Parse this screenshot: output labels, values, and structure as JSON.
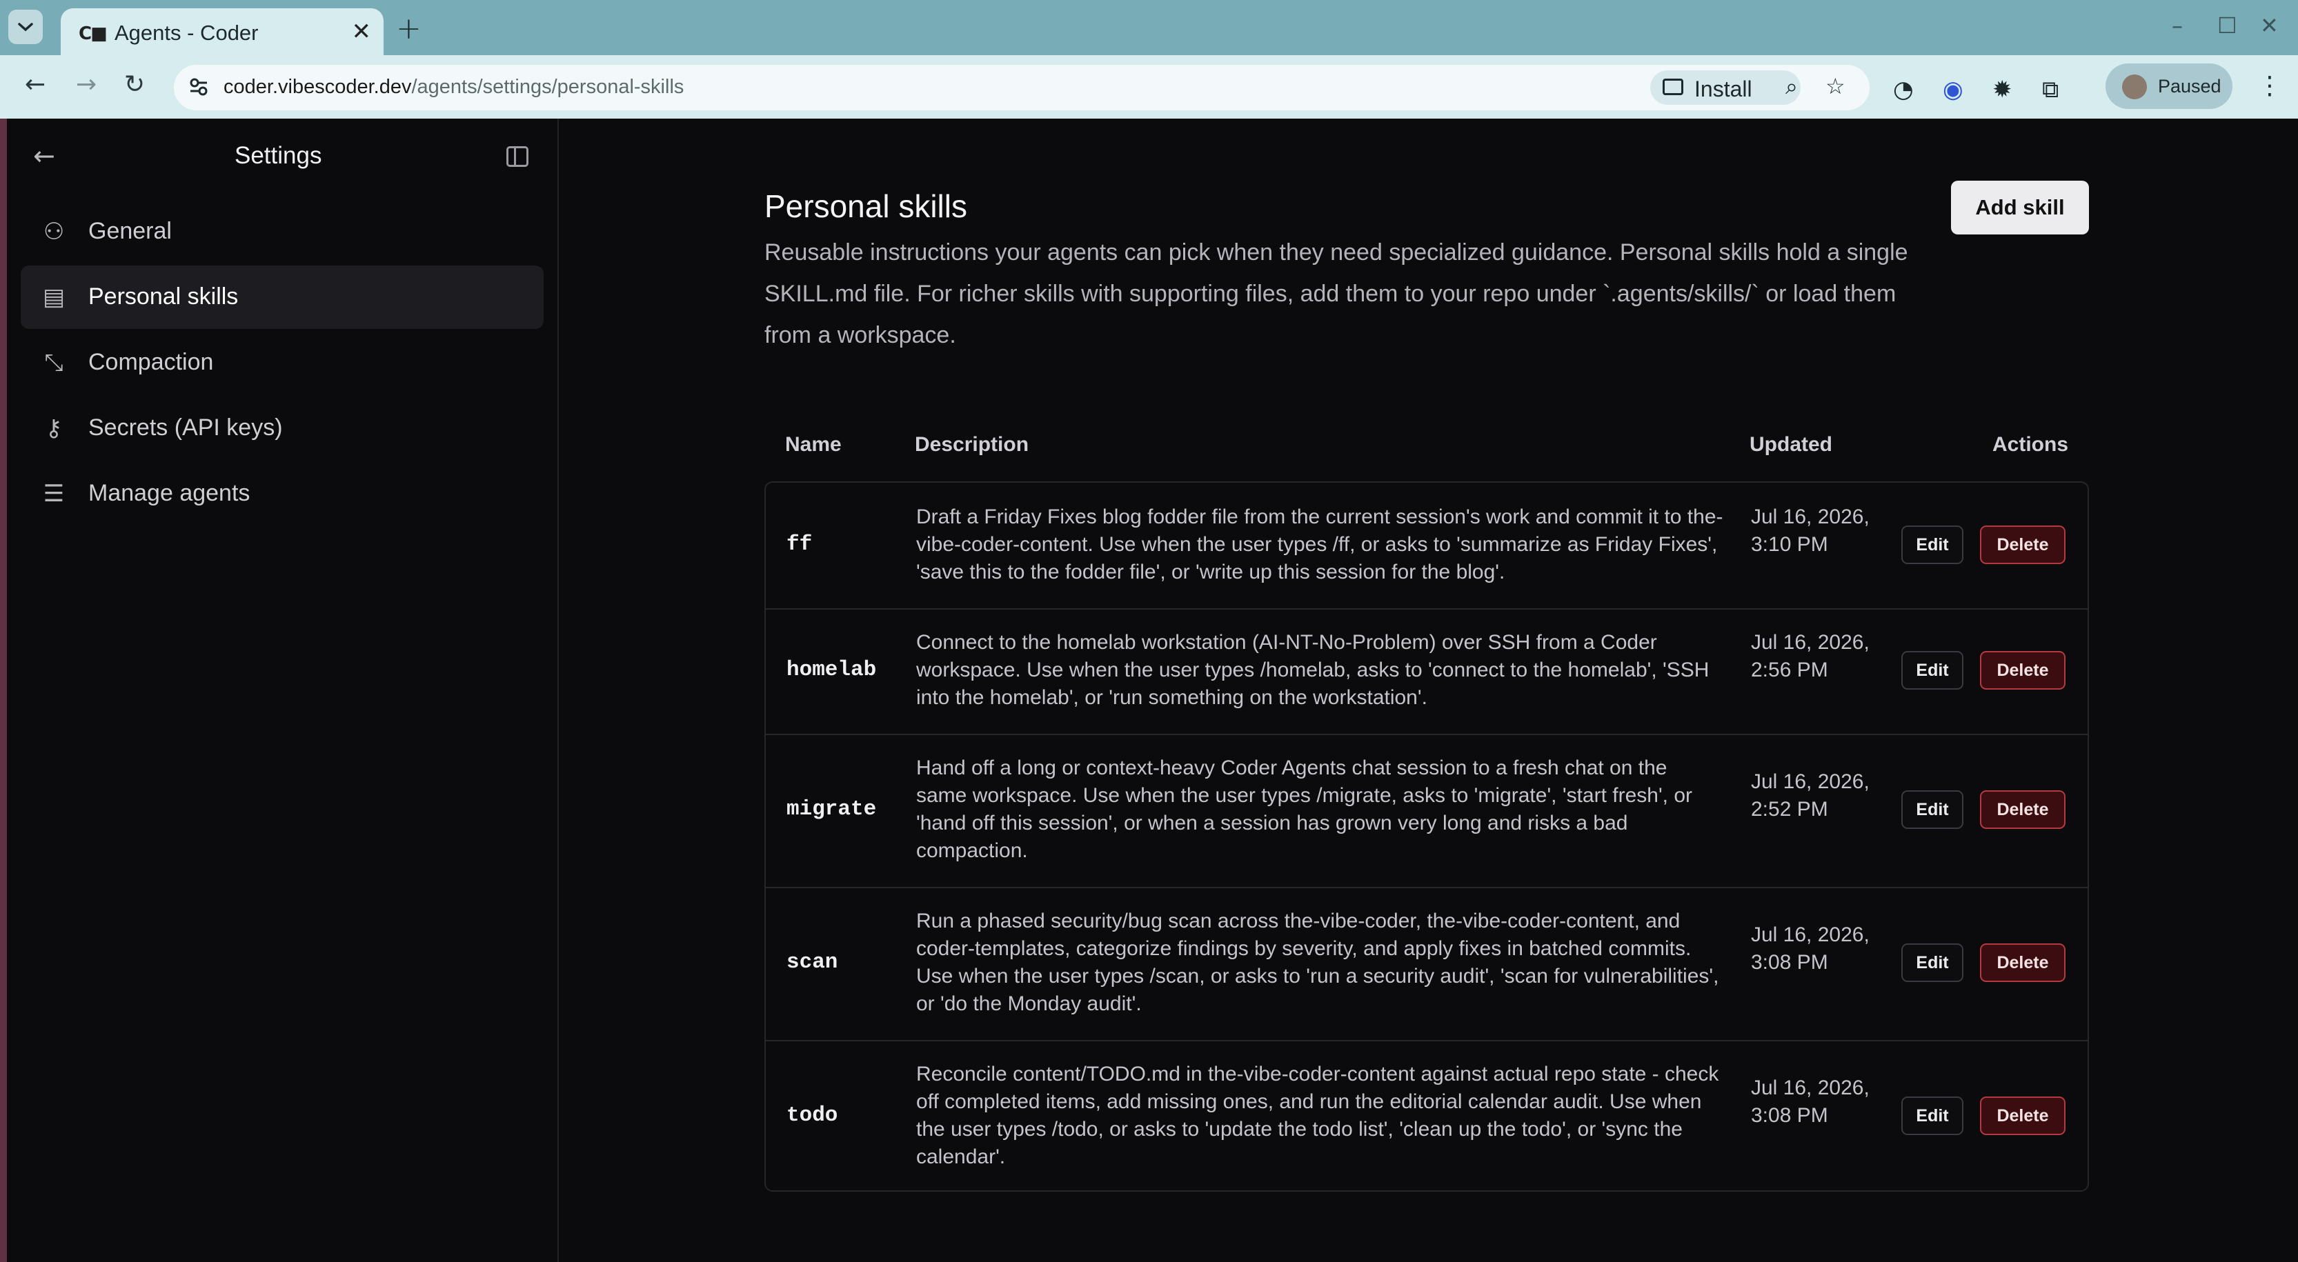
{
  "browser": {
    "tab_title": "Agents - Coder",
    "tab_favicon": "C■",
    "url_host": "coder.vibescoder.dev",
    "url_path": "/agents/settings/personal-skills",
    "install_label": "Install",
    "profile_label": "Paused"
  },
  "sidebar": {
    "title": "Settings",
    "items": [
      {
        "label": "General",
        "icon": "user-icon",
        "glyph": "⚇",
        "active": false
      },
      {
        "label": "Personal skills",
        "icon": "document-icon",
        "glyph": "▤",
        "active": true
      },
      {
        "label": "Compaction",
        "icon": "compress-icon",
        "glyph": "⤡",
        "active": false
      },
      {
        "label": "Secrets (API keys)",
        "icon": "key-icon",
        "glyph": "⚷",
        "active": false
      },
      {
        "label": "Manage agents",
        "icon": "sliders-icon",
        "glyph": "☰",
        "active": false
      }
    ]
  },
  "main": {
    "title": "Personal skills",
    "description": "Reusable instructions your agents can pick when they need specialized guidance. Personal skills hold a single SKILL.md file. For richer skills with supporting files, add them to your repo under `.agents/skills/` or load them from a workspace.",
    "add_button": "Add skill",
    "columns": {
      "name": "Name",
      "description": "Description",
      "updated": "Updated",
      "actions": "Actions"
    },
    "edit_label": "Edit",
    "delete_label": "Delete",
    "rows": [
      {
        "name": "ff",
        "description": "Draft a Friday Fixes blog fodder file from the current session's work and commit it to the-vibe-coder-content. Use when the user types /ff, or asks to 'summarize as Friday Fixes', 'save this to the fodder file', or 'write up this session for the blog'.",
        "updated": "Jul 16, 2026, 3:10 PM"
      },
      {
        "name": "homelab",
        "description": "Connect to the homelab workstation (AI-NT-No-Problem) over SSH from a Coder workspace. Use when the user types /homelab, asks to 'connect to the homelab', 'SSH into the homelab', or 'run something on the workstation'.",
        "updated": "Jul 16, 2026, 2:56 PM"
      },
      {
        "name": "migrate",
        "description": "Hand off a long or context-heavy Coder Agents chat session to a fresh chat on the same workspace. Use when the user types /migrate, asks to 'migrate', 'start fresh', or 'hand off this session', or when a session has grown very long and risks a bad compaction.",
        "updated": "Jul 16, 2026, 2:52 PM"
      },
      {
        "name": "scan",
        "description": "Run a phased security/bug scan across the-vibe-coder, the-vibe-coder-content, and coder-templates, categorize findings by severity, and apply fixes in batched commits. Use when the user types /scan, or asks to 'run a security audit', 'scan for vulnerabilities', or 'do the Monday audit'.",
        "updated": "Jul 16, 2026, 3:08 PM"
      },
      {
        "name": "todo",
        "description": "Reconcile content/TODO.md in the-vibe-coder-content against actual repo state - check off completed items, add missing ones, and run the editorial calendar audit. Use when the user types /todo, or asks to 'update the todo list', 'clean up the todo', or 'sync the calendar'.",
        "updated": "Jul 16, 2026, 3:08 PM"
      }
    ]
  }
}
